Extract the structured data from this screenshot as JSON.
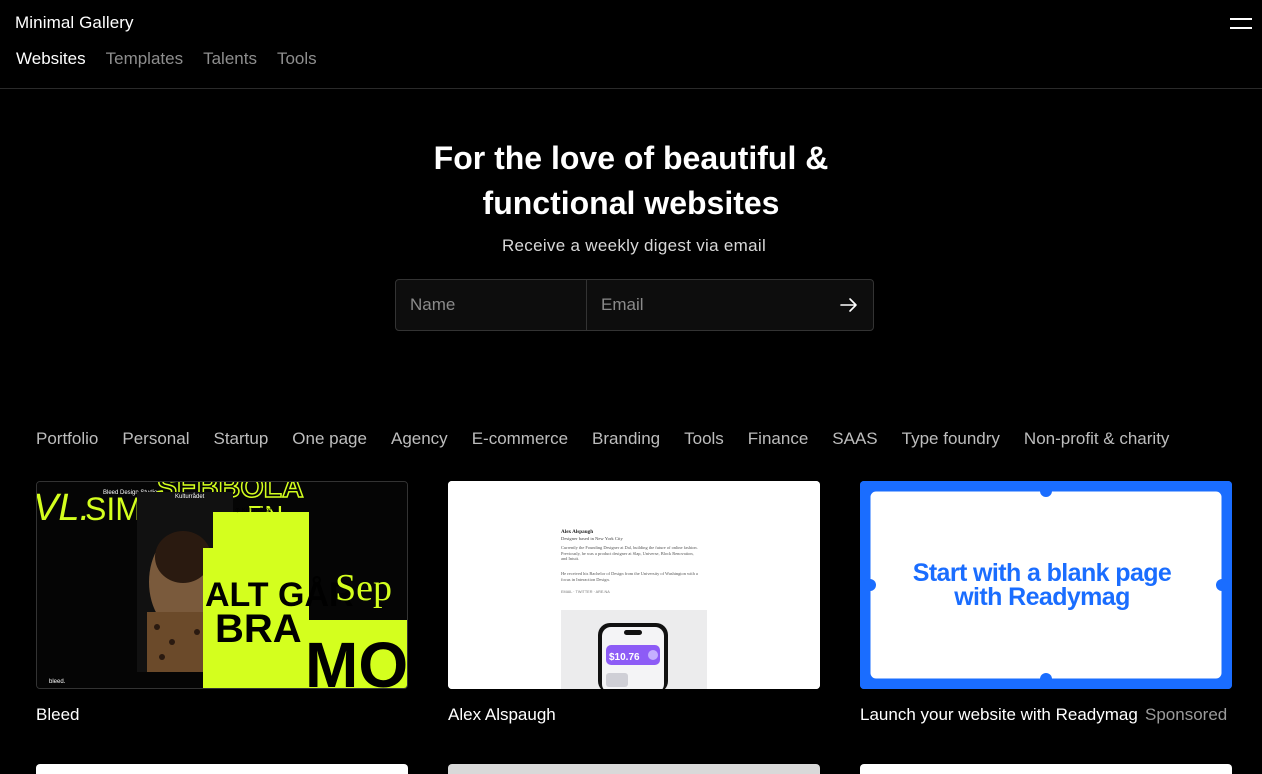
{
  "header": {
    "brand": "Minimal Gallery",
    "nav": [
      "Websites",
      "Templates",
      "Talents",
      "Tools"
    ]
  },
  "hero": {
    "title_line1": "For the love of beautiful &",
    "title_line2": "functional websites",
    "subtitle": "Receive a weekly digest via email",
    "name_placeholder": "Name",
    "email_placeholder": "Email"
  },
  "categories": [
    "Portfolio",
    "Personal",
    "Startup",
    "One page",
    "Agency",
    "E-commerce",
    "Branding",
    "Tools",
    "Finance",
    "SAAS",
    "Type foundry",
    "Non-profit & charity"
  ],
  "cards": [
    {
      "title": "Bleed",
      "preview_text": {
        "header": "Bleed Design Studio",
        "badge": "Kulturrådet",
        "big_a": "SEBBOLA",
        "big_b": "EN",
        "big_c": "ALT GÅR",
        "big_d": "BRA",
        "big_e": "Sep",
        "big_f": "MON",
        "logo": "bleed."
      }
    },
    {
      "title": "Alex Alspaugh",
      "preview_text": {
        "name": "Alex Alspaugh",
        "tagline": "Designer based in New York City",
        "para1": "Currently the Founding Designer at Dal, building the future of online fashion. Previously, he was a product designer at Slap, Universe, Block Renovation, and Intuit.",
        "para2": "He received his Bachelor of Design from the University of Washington with a focus in Interaction Design.",
        "links": "EMAIL · TWITTER · ARE.NA",
        "price": "$10.76"
      }
    },
    {
      "title": "Launch your website with Readymag",
      "sponsored": "Sponsored",
      "preview_line1": "Start with a blank page",
      "preview_line2": "with Readymag"
    }
  ],
  "colors": {
    "background": "#000000",
    "accent_lime": "#d4ff1e",
    "readymag_blue": "#1a6dff",
    "muted_text": "#8e8e8e"
  }
}
